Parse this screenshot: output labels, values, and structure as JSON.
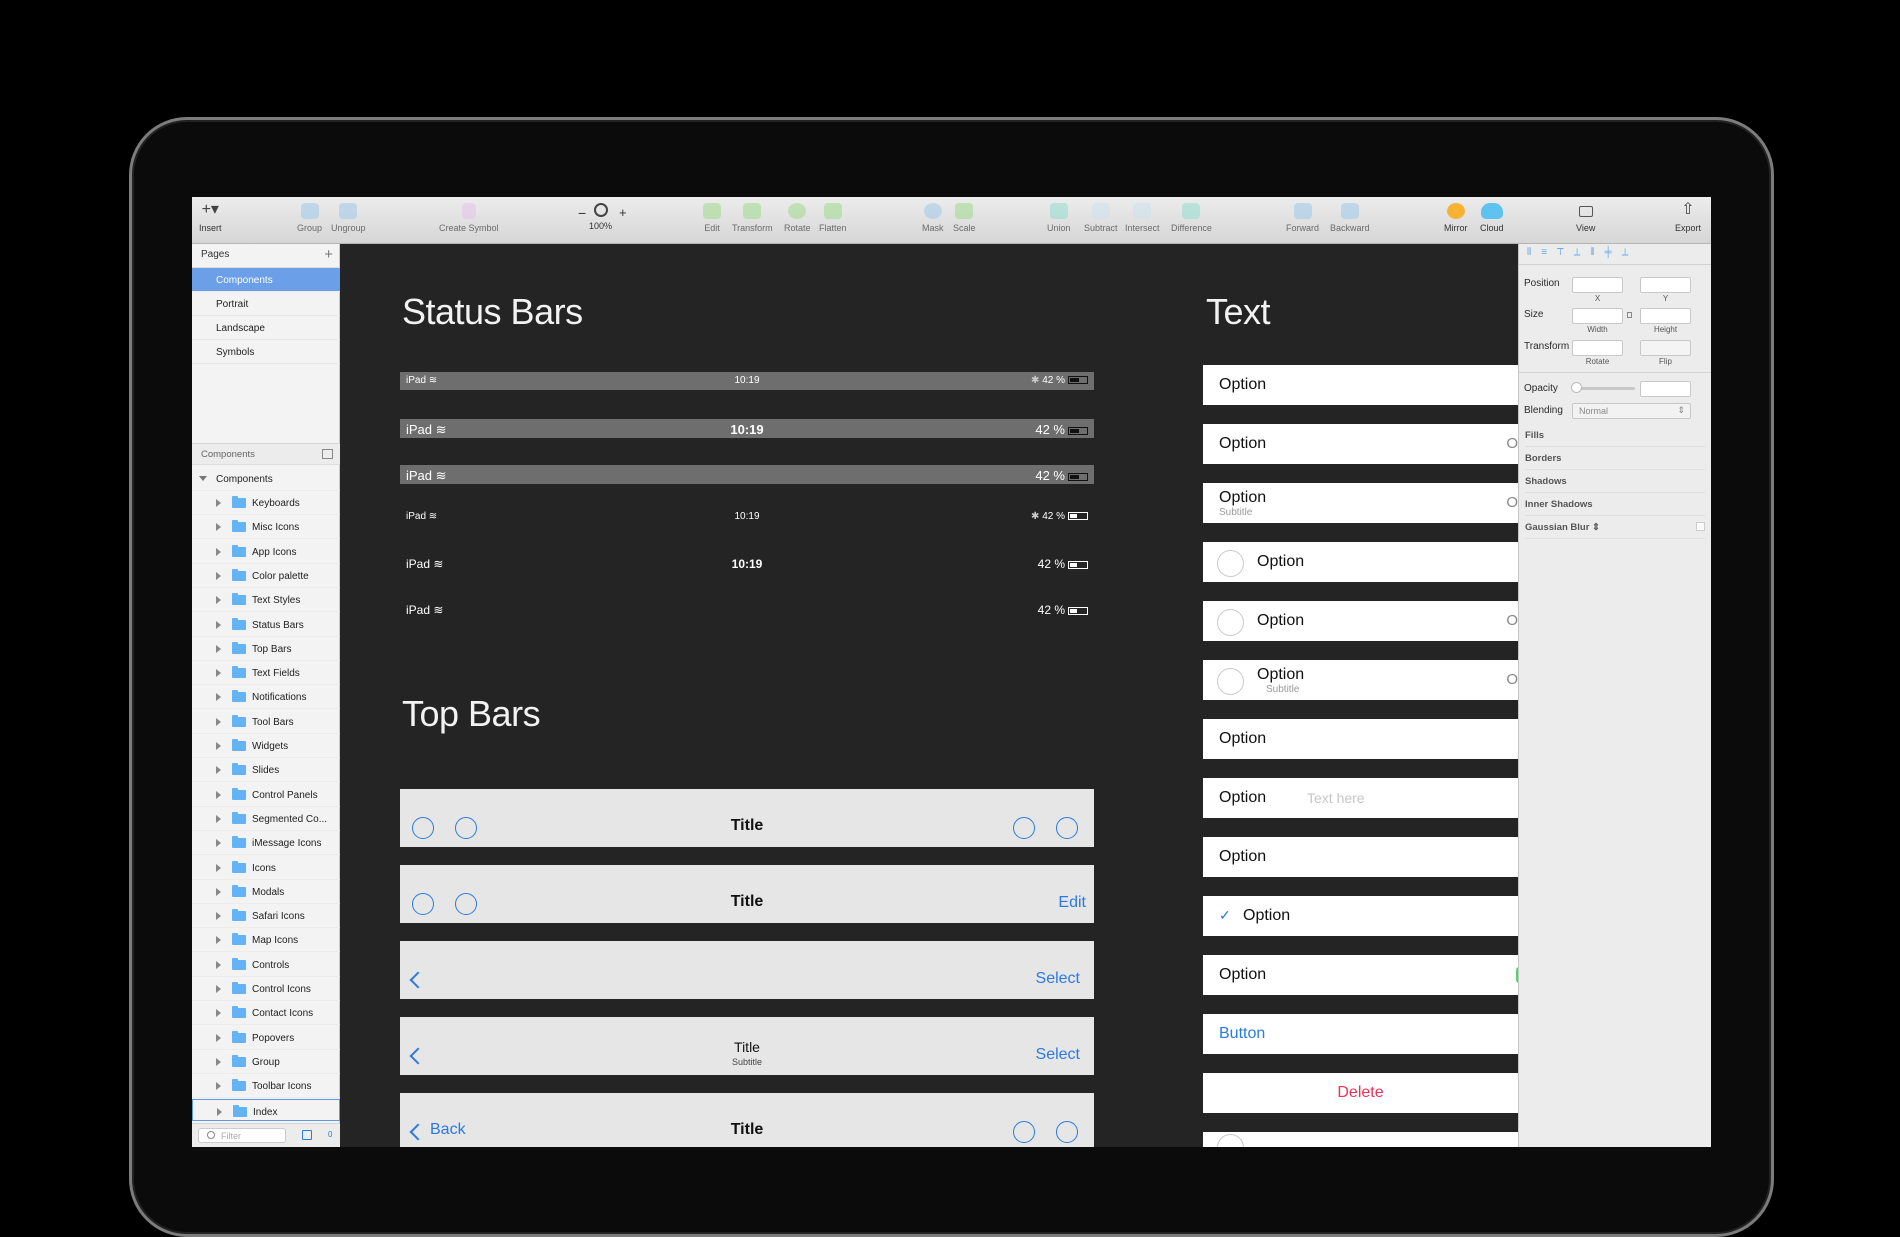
{
  "toolbar": {
    "insert": "Insert",
    "group": "Group",
    "ungroup": "Ungroup",
    "create_symbol": "Create Symbol",
    "zoom": "100%",
    "zoom_minus": "−",
    "zoom_plus": "+",
    "edit": "Edit",
    "transform": "Transform",
    "rotate": "Rotate",
    "flatten": "Flatten",
    "mask": "Mask",
    "scale": "Scale",
    "union": "Union",
    "subtract": "Subtract",
    "intersect": "Intersect",
    "difference": "Difference",
    "forward": "Forward",
    "backward": "Backward",
    "mirror": "Mirror",
    "cloud": "Cloud",
    "view": "View",
    "export": "Export"
  },
  "pages": {
    "header": "Pages",
    "add": "+",
    "items": [
      "Components",
      "Portrait",
      "Landscape",
      "Symbols"
    ]
  },
  "layers": {
    "header": "Components",
    "root": "Components",
    "items": [
      "Keyboards",
      "Misc Icons",
      "App Icons",
      "Color palette",
      "Text Styles",
      "Status Bars",
      "Top Bars",
      "Text Fields",
      "Notifications",
      "Tool Bars",
      "Widgets",
      "Slides",
      "Control Panels",
      "Segmented Co...",
      "iMessage Icons",
      "Icons",
      "Modals",
      "Safari Icons",
      "Map Icons",
      "Controls",
      "Control Icons",
      "Contact Icons",
      "Popovers",
      "Group",
      "Toolbar Icons",
      "Index"
    ],
    "filter_placeholder": "Filter",
    "count": "0"
  },
  "inspector": {
    "position": "Position",
    "x": "X",
    "y": "Y",
    "size": "Size",
    "width": "Width",
    "height": "Height",
    "transform": "Transform",
    "rotate": "Rotate",
    "flip": "Flip",
    "opacity": "Opacity",
    "blending": "Blending",
    "blending_value": "Normal",
    "fills": "Fills",
    "borders": "Borders",
    "shadows": "Shadows",
    "inner_shadows": "Inner Shadows",
    "gaussian_blur": "Gaussian Blur"
  },
  "canvas": {
    "status_heading": "Status Bars",
    "status_bars": [
      {
        "device": "iPad",
        "time": "10:19",
        "battery": "42 %",
        "bt": "✱"
      },
      {
        "device": "iPad",
        "time": "10:19",
        "battery": "42 %"
      },
      {
        "device": "iPad",
        "battery": "42 %"
      },
      {
        "device": "iPad",
        "time": "10:19",
        "battery": "42 %",
        "bt": "✱"
      },
      {
        "device": "iPad",
        "time": "10:19",
        "battery": "42 %"
      },
      {
        "device": "iPad",
        "battery": "42 %"
      }
    ],
    "top_heading": "Top Bars",
    "top_bars": [
      {
        "title": "Title"
      },
      {
        "title": "Title",
        "right": "Edit"
      },
      {
        "right": "Select"
      },
      {
        "title": "Title",
        "subtitle": "Subtitle",
        "right": "Select"
      },
      {
        "title": "Title",
        "left": "Back"
      }
    ],
    "text_heading": "Text",
    "text_rows": {
      "r1": "Option",
      "r2": "Option",
      "r3": "Option",
      "r3sub": "Subtitle",
      "r4": "Option",
      "r5": "Option",
      "r6": "Option",
      "r6sub": "Subtitle",
      "r7": "Option",
      "r8": "Option",
      "r8ph": "Text here",
      "r9": "Option",
      "r10": "Option",
      "r11": "Option",
      "r12": "Button",
      "r13": "Delete",
      "edge": "O",
      "check": "✓"
    }
  },
  "colors": {
    "accent": "#2a7ae2",
    "delete": "#e8335a",
    "selection": "#6b9fe8",
    "folder": "#63b3f5"
  }
}
